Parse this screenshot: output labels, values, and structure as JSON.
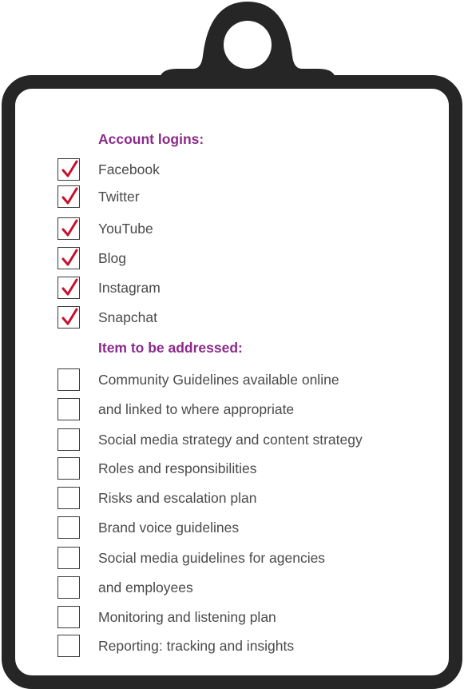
{
  "sections": [
    {
      "title": "Account logins:",
      "items": [
        {
          "label": "Facebook",
          "checked": true
        },
        {
          "label": "Twitter",
          "checked": true
        },
        {
          "label": "YouTube",
          "checked": true
        },
        {
          "label": "Blog",
          "checked": true
        },
        {
          "label": "Instagram",
          "checked": true
        },
        {
          "label": "Snapchat",
          "checked": true
        }
      ]
    },
    {
      "title": "Item to be addressed:",
      "items": [
        {
          "label": "Community Guidelines available online",
          "checked": false
        },
        {
          "label": "and linked to where appropriate",
          "checked": false
        },
        {
          "label": "Social media strategy and content strategy",
          "checked": false
        },
        {
          "label": "Roles and responsibilities",
          "checked": false
        },
        {
          "label": "Risks and escalation plan",
          "checked": false
        },
        {
          "label": "Brand voice guidelines",
          "checked": false
        },
        {
          "label": "Social media guidelines for agencies",
          "checked": false
        },
        {
          "label": "and employees",
          "checked": false
        },
        {
          "label": "Monitoring and listening plan",
          "checked": false
        },
        {
          "label": "Reporting: tracking and insights",
          "checked": false
        }
      ]
    }
  ],
  "colors": {
    "heading": "#8b2a8a",
    "checkmark": "#c8102e",
    "board": "#262626"
  }
}
